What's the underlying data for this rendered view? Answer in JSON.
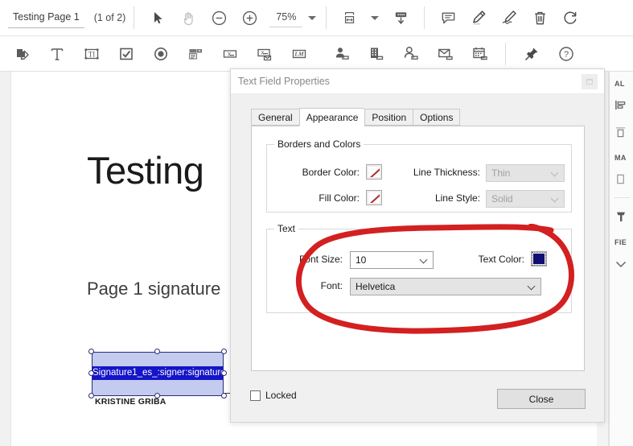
{
  "toolbar_top": {
    "doc_tab_label": "Testing Page 1",
    "page_count": "(1 of 2)",
    "zoom_level": "75%",
    "buttons": [
      {
        "name": "select-tool",
        "icon": "cursor-arrow-icon"
      },
      {
        "name": "hand-tool",
        "icon": "hand-icon"
      },
      {
        "name": "zoom-out",
        "icon": "minus-circle-icon"
      },
      {
        "name": "zoom-in",
        "icon": "plus-circle-icon"
      },
      {
        "name": "fit-page",
        "icon": "fit-width-icon"
      },
      {
        "name": "download",
        "icon": "download-icon"
      },
      {
        "name": "comment",
        "icon": "comment-icon"
      },
      {
        "name": "highlight",
        "icon": "highlighter-icon"
      },
      {
        "name": "sign",
        "icon": "sign-pen-icon"
      },
      {
        "name": "delete",
        "icon": "trash-icon"
      },
      {
        "name": "rotate",
        "icon": "rotate-icon"
      }
    ]
  },
  "toolbar_fields": {
    "buttons": [
      {
        "name": "add-signature-field",
        "icon": "signature-field-icon"
      },
      {
        "name": "add-text-field",
        "icon": "text-field-icon"
      },
      {
        "name": "add-text-box-field",
        "icon": "textbox-field-icon"
      },
      {
        "name": "add-checkbox-field",
        "icon": "checkbox-field-icon"
      },
      {
        "name": "add-radio-field",
        "icon": "radio-field-icon"
      },
      {
        "name": "add-dropdown-field",
        "icon": "dropdown-field-icon"
      },
      {
        "name": "add-initials-field",
        "icon": "initials-field-icon"
      },
      {
        "name": "add-stamp-field",
        "icon": "stamp-field-icon"
      },
      {
        "name": "add-lm-field",
        "icon": "lm-field-icon"
      },
      {
        "name": "add-signer-name-field",
        "icon": "signer-name-icon"
      },
      {
        "name": "add-company-field",
        "icon": "company-icon"
      },
      {
        "name": "add-title-field",
        "icon": "job-title-icon"
      },
      {
        "name": "add-email-field",
        "icon": "email-icon"
      },
      {
        "name": "add-date-field",
        "icon": "calendar-icon"
      },
      {
        "name": "pin-toolbar",
        "icon": "pin-icon"
      },
      {
        "name": "help",
        "icon": "help-circle-icon"
      }
    ]
  },
  "document": {
    "title": "Testing",
    "subtitle": "Page 1 signature",
    "signature_field_text": "Signature1_es_:signer:signature",
    "signer_name": "KRISTINE GRIBA"
  },
  "right_sidebar": {
    "sections": [
      {
        "heading": "AL",
        "icons": [
          {
            "name": "align-left-icon"
          },
          {
            "name": "distribute-icon"
          }
        ]
      },
      {
        "heading": "MA",
        "icons": [
          {
            "name": "match-size-icon"
          }
        ]
      },
      {
        "heading": "",
        "icons": [
          {
            "name": "hammer-tool-icon"
          }
        ]
      },
      {
        "heading": "FIE",
        "icons": [
          {
            "name": "chevron-down-icon"
          }
        ]
      }
    ]
  },
  "dialog": {
    "title": "Text Field Properties",
    "tabs": [
      {
        "label": "General",
        "active": false
      },
      {
        "label": "Appearance",
        "active": true
      },
      {
        "label": "Position",
        "active": false
      },
      {
        "label": "Options",
        "active": false
      }
    ],
    "borders_group": {
      "legend": "Borders and Colors",
      "border_color_label": "Border Color:",
      "border_color_value": "none",
      "fill_color_label": "Fill Color:",
      "fill_color_value": "none",
      "line_thickness_label": "Line Thickness:",
      "line_thickness_value": "Thin",
      "line_style_label": "Line Style:",
      "line_style_value": "Solid"
    },
    "text_group": {
      "legend": "Text",
      "font_size_label": "Font Size:",
      "font_size_value": "10",
      "text_color_label": "Text Color:",
      "text_color_value": "#101073",
      "font_label": "Font:",
      "font_value": "Helvetica"
    },
    "locked_label": "Locked",
    "locked_checked": false,
    "close_button": "Close"
  },
  "colors": {
    "selection_blue": "#1414c8",
    "field_fill": "#c3cbef",
    "annotation_red": "#d32020",
    "no_color_slash": "#b12c28"
  }
}
